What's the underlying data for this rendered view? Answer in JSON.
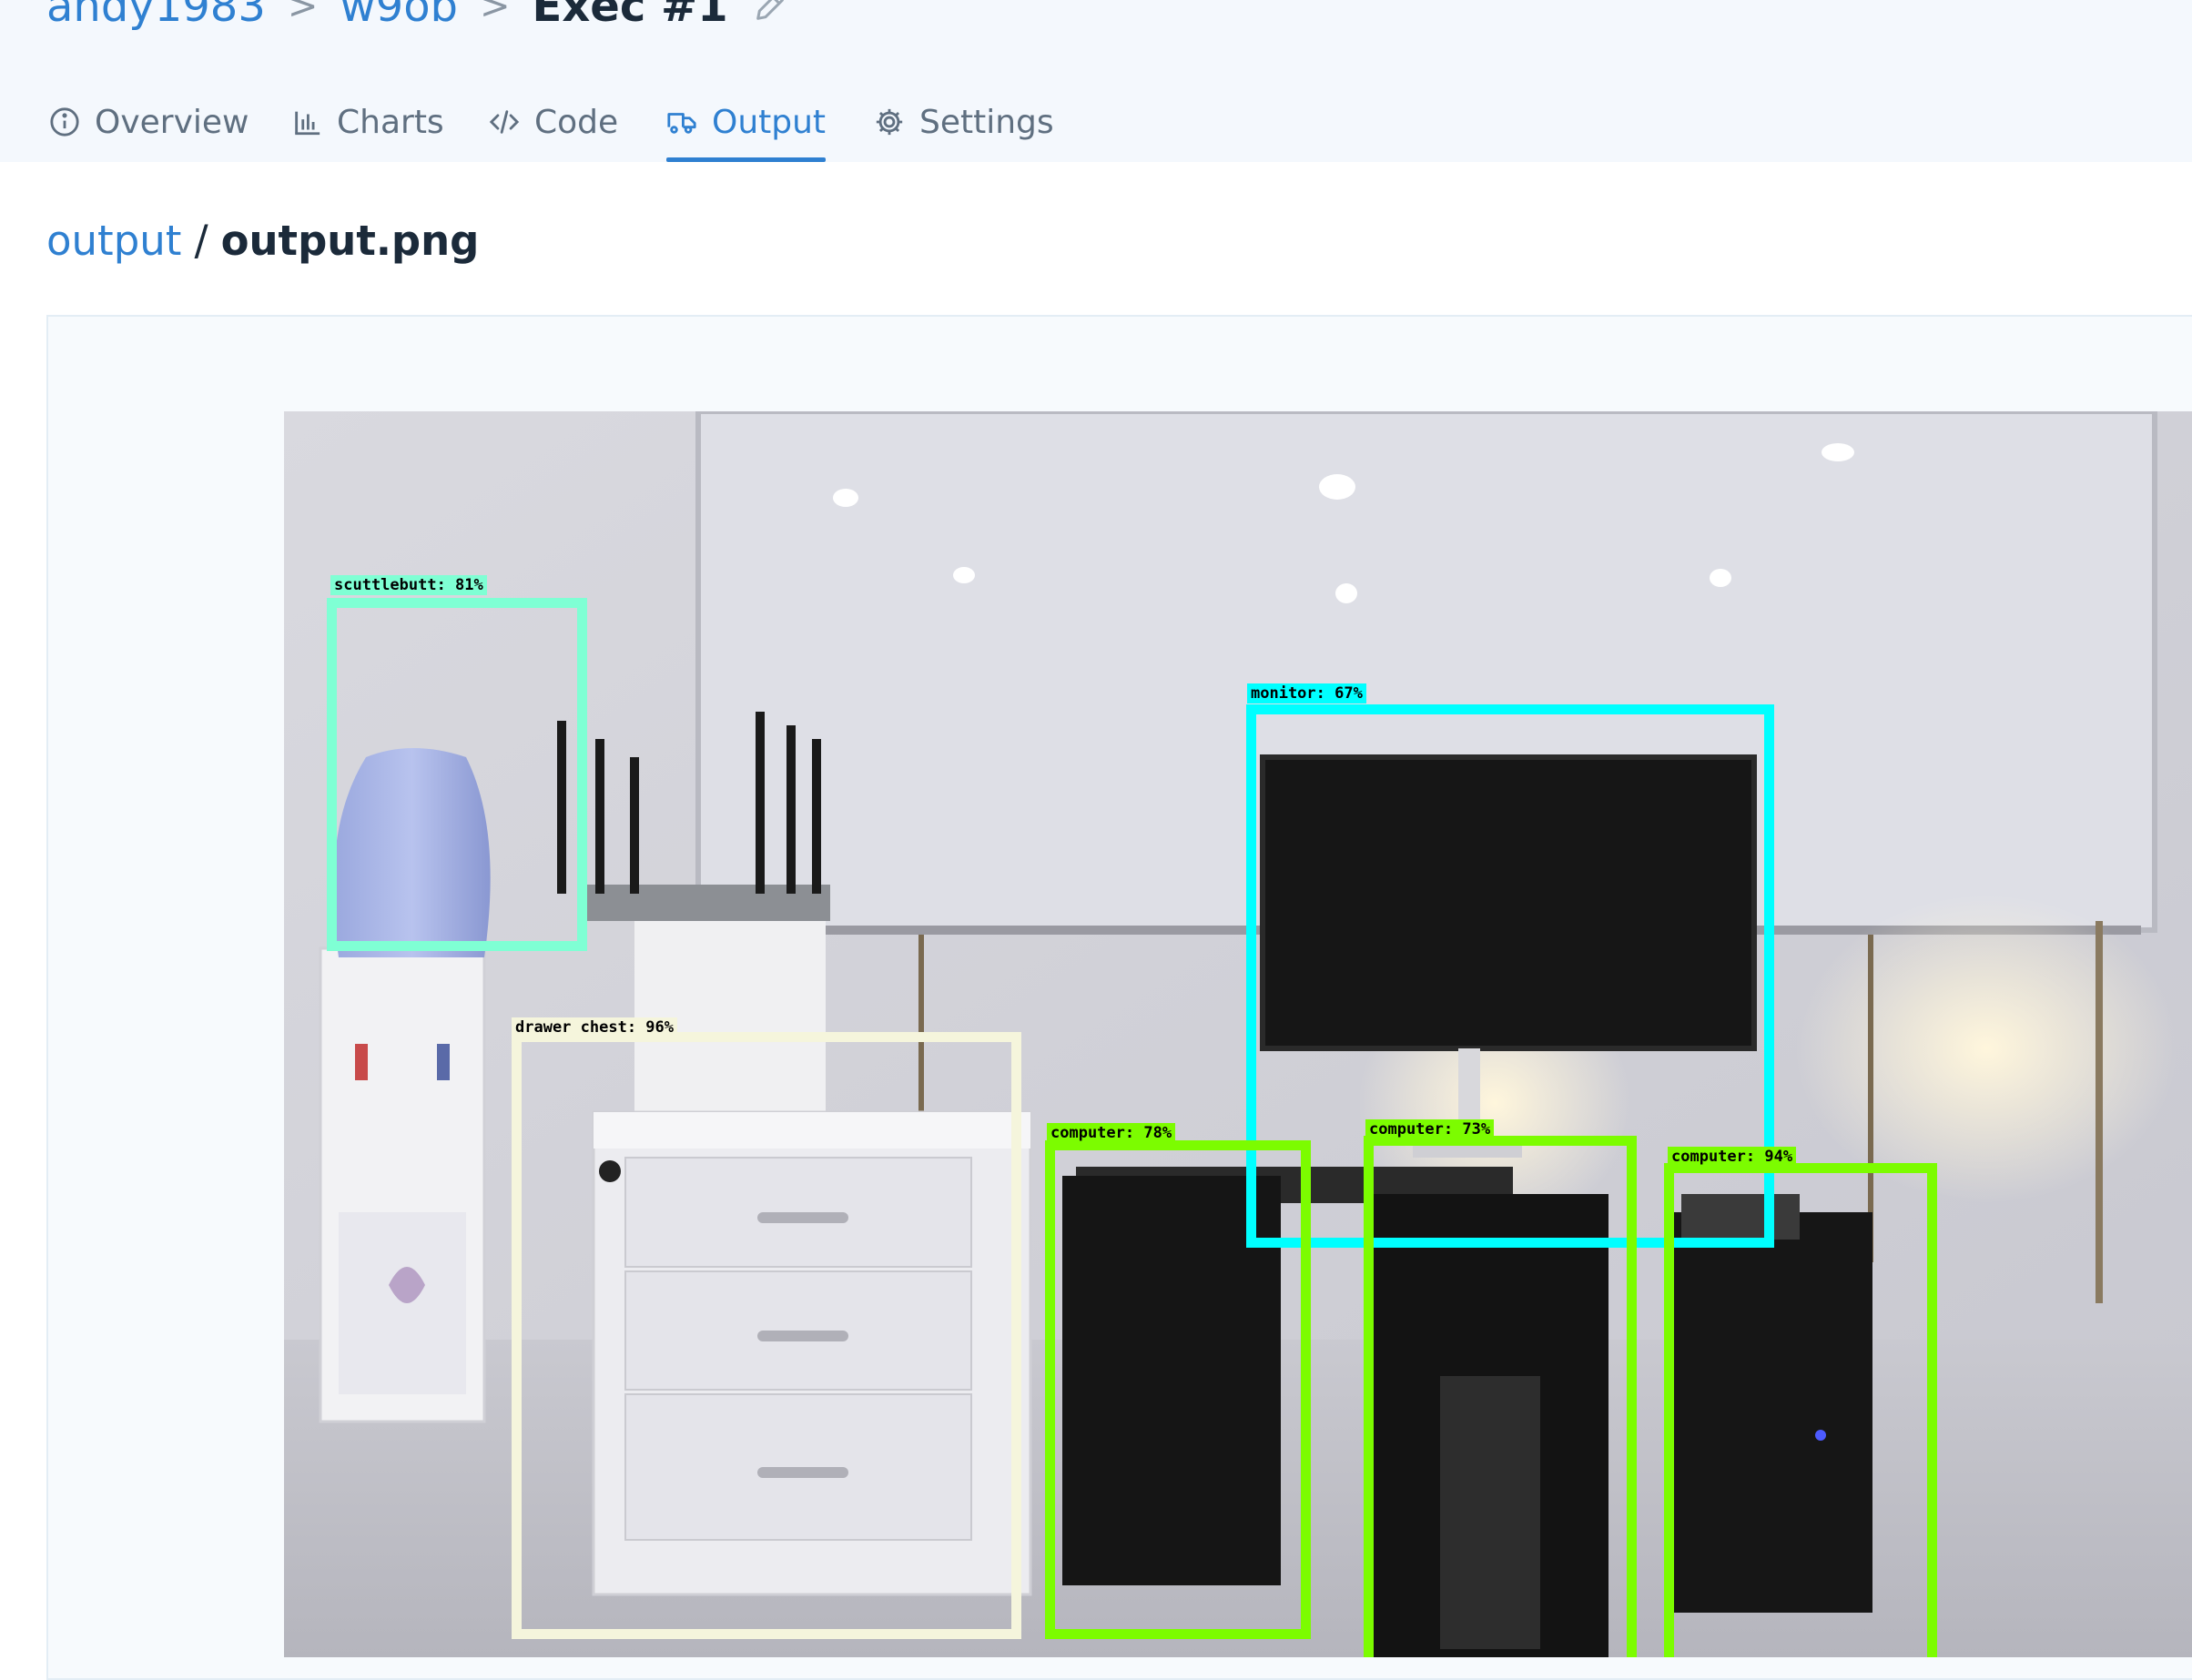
{
  "breadcrumb": {
    "items": [
      "andy1983",
      "w9ob",
      "Exec #1"
    ],
    "edit_icon": "pencil-icon"
  },
  "tabs": [
    {
      "label": "Overview",
      "icon": "info-circle-icon",
      "active": false
    },
    {
      "label": "Charts",
      "icon": "bar-chart-icon",
      "active": false
    },
    {
      "label": "Code",
      "icon": "code-icon",
      "active": false
    },
    {
      "label": "Output",
      "icon": "truck-icon",
      "active": true
    },
    {
      "label": "Settings",
      "icon": "gear-icon",
      "active": false
    }
  ],
  "file_path": {
    "folder": "output",
    "separator": "/",
    "file": "output.png"
  },
  "detections": [
    {
      "label": "scuttlebutt: 81%",
      "color": "#7fffd4"
    },
    {
      "label": "drawer chest: 96%",
      "color": "#f5f5dc"
    },
    {
      "label": "monitor: 67%",
      "color": "#00ffff"
    },
    {
      "label": "computer: 78%",
      "color": "#7cfc00"
    },
    {
      "label": "computer: 73%",
      "color": "#7cfc00"
    },
    {
      "label": "computer: 94%",
      "color": "#7cfc00"
    }
  ],
  "colors": {
    "accent": "#2f80d1",
    "topbar_bg": "#f4f8fd"
  }
}
